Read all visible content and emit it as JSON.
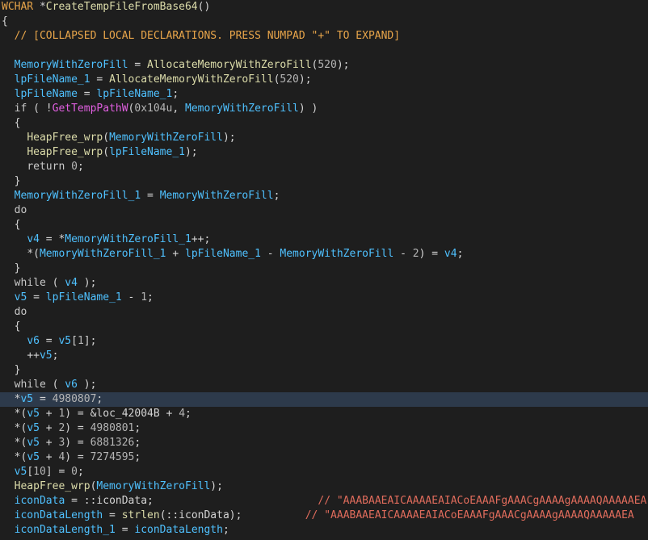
{
  "window": {
    "title": "Pseudocode view"
  },
  "colors": {
    "background": "#1e1e1e",
    "highlight": "#2d3a4b",
    "variable": "#4fc1ff",
    "function": "#dcdcaa",
    "import": "#e05fe0",
    "comment": "#e06c5c",
    "header": "#e8a54a"
  },
  "lines": [
    [
      [
        "col",
        "WCHAR"
      ],
      [
        "sp",
        " "
      ],
      [
        "punc",
        "*"
      ],
      [
        "fn",
        "CreateTempFileFromBase64"
      ],
      [
        "punc",
        "()"
      ]
    ],
    [
      [
        "punc",
        "{"
      ]
    ],
    [
      [
        "sp",
        "  "
      ],
      [
        "col",
        "// [COLLAPSED LOCAL DECLARATIONS. PRESS NUMPAD \"+\" TO EXPAND]"
      ]
    ],
    [],
    [
      [
        "sp",
        "  "
      ],
      [
        "var",
        "MemoryWithZeroFill"
      ],
      [
        "punc",
        " = "
      ],
      [
        "fn",
        "AllocateMemoryWithZeroFill"
      ],
      [
        "punc",
        "("
      ],
      [
        "num",
        "520"
      ],
      [
        "punc",
        ");"
      ]
    ],
    [
      [
        "sp",
        "  "
      ],
      [
        "var",
        "lpFileName_1"
      ],
      [
        "punc",
        " = "
      ],
      [
        "fn",
        "AllocateMemoryWithZeroFill"
      ],
      [
        "punc",
        "("
      ],
      [
        "num",
        "520"
      ],
      [
        "punc",
        ");"
      ]
    ],
    [
      [
        "sp",
        "  "
      ],
      [
        "var",
        "lpFileName"
      ],
      [
        "punc",
        " = "
      ],
      [
        "var",
        "lpFileName_1"
      ],
      [
        "punc",
        ";"
      ]
    ],
    [
      [
        "sp",
        "  "
      ],
      [
        "kw",
        "if"
      ],
      [
        "punc",
        " ( !"
      ],
      [
        "api",
        "GetTempPathW"
      ],
      [
        "punc",
        "("
      ],
      [
        "num",
        "0x104u"
      ],
      [
        "punc",
        ", "
      ],
      [
        "var",
        "MemoryWithZeroFill"
      ],
      [
        "punc",
        ") )"
      ]
    ],
    [
      [
        "sp",
        "  "
      ],
      [
        "punc",
        "{"
      ]
    ],
    [
      [
        "sp",
        "    "
      ],
      [
        "fn",
        "HeapFree_wrp"
      ],
      [
        "punc",
        "("
      ],
      [
        "var",
        "MemoryWithZeroFill"
      ],
      [
        "punc",
        ");"
      ]
    ],
    [
      [
        "sp",
        "    "
      ],
      [
        "fn",
        "HeapFree_wrp"
      ],
      [
        "punc",
        "("
      ],
      [
        "var",
        "lpFileName_1"
      ],
      [
        "punc",
        ");"
      ]
    ],
    [
      [
        "sp",
        "    "
      ],
      [
        "kw",
        "return"
      ],
      [
        "punc",
        " "
      ],
      [
        "num",
        "0"
      ],
      [
        "punc",
        ";"
      ]
    ],
    [
      [
        "sp",
        "  "
      ],
      [
        "punc",
        "}"
      ]
    ],
    [
      [
        "sp",
        "  "
      ],
      [
        "var",
        "MemoryWithZeroFill_1"
      ],
      [
        "punc",
        " = "
      ],
      [
        "var",
        "MemoryWithZeroFill"
      ],
      [
        "punc",
        ";"
      ]
    ],
    [
      [
        "sp",
        "  "
      ],
      [
        "kw",
        "do"
      ]
    ],
    [
      [
        "sp",
        "  "
      ],
      [
        "punc",
        "{"
      ]
    ],
    [
      [
        "sp",
        "    "
      ],
      [
        "var",
        "v4"
      ],
      [
        "punc",
        " = *"
      ],
      [
        "var",
        "MemoryWithZeroFill_1"
      ],
      [
        "punc",
        "++;"
      ]
    ],
    [
      [
        "sp",
        "    "
      ],
      [
        "punc",
        "*("
      ],
      [
        "var",
        "MemoryWithZeroFill_1"
      ],
      [
        "punc",
        " + "
      ],
      [
        "var",
        "lpFileName_1"
      ],
      [
        "punc",
        " - "
      ],
      [
        "var",
        "MemoryWithZeroFill"
      ],
      [
        "punc",
        " - "
      ],
      [
        "num",
        "2"
      ],
      [
        "punc",
        ") = "
      ],
      [
        "var",
        "v4"
      ],
      [
        "punc",
        ";"
      ]
    ],
    [
      [
        "sp",
        "  "
      ],
      [
        "punc",
        "}"
      ]
    ],
    [
      [
        "sp",
        "  "
      ],
      [
        "kw",
        "while"
      ],
      [
        "punc",
        " ( "
      ],
      [
        "var",
        "v4"
      ],
      [
        "punc",
        " );"
      ]
    ],
    [
      [
        "sp",
        "  "
      ],
      [
        "var",
        "v5"
      ],
      [
        "punc",
        " = "
      ],
      [
        "var",
        "lpFileName_1"
      ],
      [
        "punc",
        " - "
      ],
      [
        "num",
        "1"
      ],
      [
        "punc",
        ";"
      ]
    ],
    [
      [
        "sp",
        "  "
      ],
      [
        "kw",
        "do"
      ]
    ],
    [
      [
        "sp",
        "  "
      ],
      [
        "punc",
        "{"
      ]
    ],
    [
      [
        "sp",
        "    "
      ],
      [
        "var",
        "v6"
      ],
      [
        "punc",
        " = "
      ],
      [
        "var",
        "v5"
      ],
      [
        "punc",
        "["
      ],
      [
        "num",
        "1"
      ],
      [
        "punc",
        "];"
      ]
    ],
    [
      [
        "sp",
        "    "
      ],
      [
        "punc",
        "++"
      ],
      [
        "var",
        "v5"
      ],
      [
        "punc",
        ";"
      ]
    ],
    [
      [
        "sp",
        "  "
      ],
      [
        "punc",
        "}"
      ]
    ],
    [
      [
        "sp",
        "  "
      ],
      [
        "kw",
        "while"
      ],
      [
        "punc",
        " ( "
      ],
      [
        "var",
        "v6"
      ],
      [
        "punc",
        " );"
      ]
    ],
    [
      [
        "sp",
        "  "
      ],
      [
        "punc",
        "*"
      ],
      [
        "var",
        "v5"
      ],
      [
        "punc",
        " = "
      ],
      [
        "num",
        "4980807"
      ],
      [
        "punc",
        ";"
      ]
    ],
    [
      [
        "sp",
        "  "
      ],
      [
        "punc",
        "*("
      ],
      [
        "var",
        "v5"
      ],
      [
        "punc",
        " + "
      ],
      [
        "num",
        "1"
      ],
      [
        "punc",
        ") = &"
      ],
      [
        "lbl",
        "loc_42004B"
      ],
      [
        "punc",
        " + "
      ],
      [
        "num",
        "4"
      ],
      [
        "punc",
        ";"
      ]
    ],
    [
      [
        "sp",
        "  "
      ],
      [
        "punc",
        "*("
      ],
      [
        "var",
        "v5"
      ],
      [
        "punc",
        " + "
      ],
      [
        "num",
        "2"
      ],
      [
        "punc",
        ") = "
      ],
      [
        "num",
        "4980801"
      ],
      [
        "punc",
        ";"
      ]
    ],
    [
      [
        "sp",
        "  "
      ],
      [
        "punc",
        "*("
      ],
      [
        "var",
        "v5"
      ],
      [
        "punc",
        " + "
      ],
      [
        "num",
        "3"
      ],
      [
        "punc",
        ") = "
      ],
      [
        "num",
        "6881326"
      ],
      [
        "punc",
        ";"
      ]
    ],
    [
      [
        "sp",
        "  "
      ],
      [
        "punc",
        "*("
      ],
      [
        "var",
        "v5"
      ],
      [
        "punc",
        " + "
      ],
      [
        "num",
        "4"
      ],
      [
        "punc",
        ") = "
      ],
      [
        "num",
        "7274595"
      ],
      [
        "punc",
        ";"
      ]
    ],
    [
      [
        "sp",
        "  "
      ],
      [
        "var",
        "v5"
      ],
      [
        "punc",
        "["
      ],
      [
        "num",
        "10"
      ],
      [
        "punc",
        "] = "
      ],
      [
        "num",
        "0"
      ],
      [
        "punc",
        ";"
      ]
    ],
    [
      [
        "sp",
        "  "
      ],
      [
        "fn",
        "HeapFree_wrp"
      ],
      [
        "punc",
        "("
      ],
      [
        "var",
        "MemoryWithZeroFill"
      ],
      [
        "punc",
        ");"
      ]
    ],
    [
      [
        "sp",
        "  "
      ],
      [
        "var",
        "iconData"
      ],
      [
        "punc",
        " = ::"
      ],
      [
        "id",
        "iconData"
      ],
      [
        "punc",
        ";"
      ],
      [
        "sp",
        "                          "
      ],
      [
        "cmt",
        "// \"AAABAAEAICAAAAEAIACoEAAAFgAAACgAAAAgAAAAQAAAAAEA"
      ]
    ],
    [
      [
        "sp",
        "  "
      ],
      [
        "var",
        "iconDataLength"
      ],
      [
        "punc",
        " = "
      ],
      [
        "fn",
        "strlen"
      ],
      [
        "punc",
        "(::"
      ],
      [
        "id",
        "iconData"
      ],
      [
        "punc",
        ");"
      ],
      [
        "sp",
        "          "
      ],
      [
        "cmt",
        "// \"AAABAAEAICAAAAEAIACoEAAAFgAAACgAAAAgAAAAQAAAAAEA"
      ]
    ],
    [
      [
        "sp",
        "  "
      ],
      [
        "var",
        "iconDataLength_1"
      ],
      [
        "punc",
        " = "
      ],
      [
        "var",
        "iconDataLength"
      ],
      [
        "punc",
        ";"
      ]
    ]
  ],
  "highlighted_line": 27
}
